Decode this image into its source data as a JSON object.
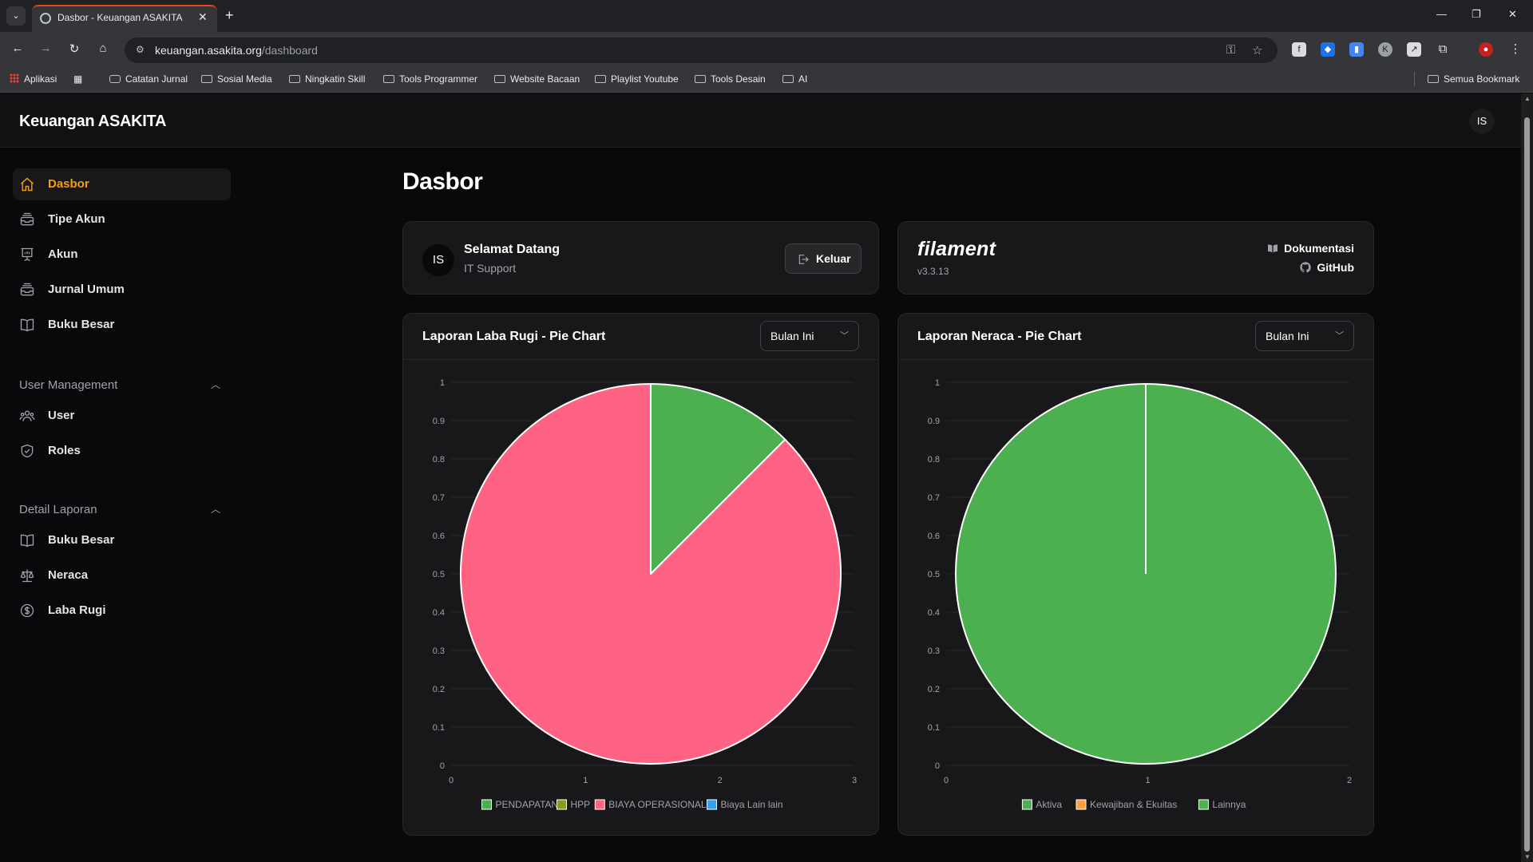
{
  "browser": {
    "tab_title": "Dasbor - Keuangan ASAKITA",
    "url_host": "keuangan.asakita.org",
    "url_path": "/dashboard",
    "bookmarks": [
      "Aplikasi",
      "Catatan Jurnal",
      "Sosial Media",
      "Ningkatin Skill",
      "Tools Programmer",
      "Website Bacaan",
      "Playlist Youtube",
      "Tools Desain",
      "AI"
    ],
    "all_bookmarks": "Semua Bookmark"
  },
  "app": {
    "brand": "Keuangan ASAKITA",
    "user_initials": "IS"
  },
  "sidebar": {
    "items": [
      {
        "label": "Dasbor",
        "icon": "home-icon",
        "active": true
      },
      {
        "label": "Tipe Akun",
        "icon": "inbox-stack-icon"
      },
      {
        "label": "Akun",
        "icon": "presentation-chart-icon"
      },
      {
        "label": "Jurnal Umum",
        "icon": "inbox-stack-icon"
      },
      {
        "label": "Buku Besar",
        "icon": "book-open-icon"
      }
    ],
    "groups": [
      {
        "label": "User Management",
        "items": [
          {
            "label": "User",
            "icon": "users-icon"
          },
          {
            "label": "Roles",
            "icon": "shield-check-icon"
          }
        ]
      },
      {
        "label": "Detail Laporan",
        "items": [
          {
            "label": "Buku Besar",
            "icon": "book-open-icon"
          },
          {
            "label": "Neraca",
            "icon": "scale-icon"
          },
          {
            "label": "Laba Rugi",
            "icon": "currency-dollar-icon"
          }
        ]
      }
    ]
  },
  "main": {
    "title": "Dasbor",
    "welcome": {
      "avatar": "IS",
      "title": "Selamat Datang",
      "subtitle": "IT Support",
      "logout": "Keluar"
    },
    "filament": {
      "logo": "filament",
      "version": "v3.3.13",
      "docs": "Dokumentasi",
      "github": "GitHub"
    },
    "select_label": "Bulan Ini"
  },
  "colors": {
    "accent": "#f59e0b",
    "green": "#4caf50",
    "pink": "#ff6384",
    "olive": "#8c9a20",
    "blue": "#36a2eb",
    "orange": "#ff9f40"
  },
  "chart_data": [
    {
      "type": "pie",
      "title": "Laporan Laba Rugi - Pie Chart",
      "categories": [
        "PENDAPATAN",
        "HPP",
        "BIAYA OPERASIONAL",
        "Biaya Lain lain"
      ],
      "values": [
        12.5,
        0,
        87.5,
        0
      ],
      "colors": [
        "#4caf50",
        "#8c9a20",
        "#ff6384",
        "#36a2eb"
      ],
      "x_ticks": [
        "0",
        "1",
        "2",
        "3"
      ],
      "y_ticks": [
        "0",
        "0.1",
        "0.2",
        "0.3",
        "0.4",
        "0.5",
        "0.6",
        "0.7",
        "0.8",
        "0.9",
        "1"
      ],
      "legend": "bottom"
    },
    {
      "type": "pie",
      "title": "Laporan Neraca - Pie Chart",
      "categories": [
        "Aktiva",
        "Kewajiban & Ekuitas",
        "Lainnya"
      ],
      "values": [
        100,
        0,
        0
      ],
      "colors": [
        "#4caf50",
        "#ff9f40",
        "#4caf50"
      ],
      "x_ticks": [
        "0",
        "1",
        "2"
      ],
      "y_ticks": [
        "0",
        "0.1",
        "0.2",
        "0.3",
        "0.4",
        "0.5",
        "0.6",
        "0.7",
        "0.8",
        "0.9",
        "1"
      ],
      "legend": "bottom"
    }
  ]
}
